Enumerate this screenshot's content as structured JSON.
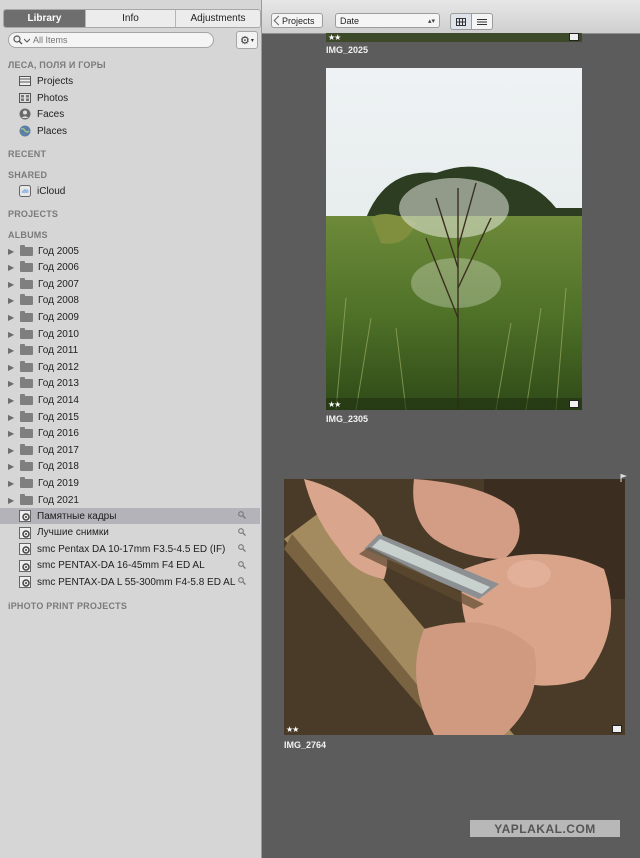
{
  "sidebar": {
    "tabs": [
      {
        "label": "Library",
        "active": true
      },
      {
        "label": "Info",
        "active": false
      },
      {
        "label": "Adjustments",
        "active": false
      }
    ],
    "search_placeholder": "All Items",
    "library_title": "ЛЕСА, ПОЛЯ И ГОРЫ",
    "library_items": [
      {
        "label": "Projects",
        "icon": "projects-icon"
      },
      {
        "label": "Photos",
        "icon": "photos-icon"
      },
      {
        "label": "Faces",
        "icon": "faces-icon"
      },
      {
        "label": "Places",
        "icon": "places-icon"
      }
    ],
    "recent_title": "RECENT",
    "shared_title": "SHARED",
    "shared_items": [
      {
        "label": "iCloud",
        "icon": "icloud-icon"
      }
    ],
    "projects_title": "PROJECTS",
    "albums_title": "ALBUMS",
    "album_folders": [
      "Год 2005",
      "Год 2006",
      "Год 2007",
      "Год 2008",
      "Год 2009",
      "Год 2010",
      "Год 2011",
      "Год 2012",
      "Год 2013",
      "Год 2014",
      "Год 2015",
      "Год 2016",
      "Год 2017",
      "Год 2018",
      "Год 2019",
      "Год 2021"
    ],
    "smart_albums": [
      {
        "label": "Памятные кадры",
        "selected": true
      },
      {
        "label": "Лучшие снимки",
        "selected": false
      },
      {
        "label": "smc Pentax DA 10-17mm F3.5-4.5 ED (IF)",
        "selected": false
      },
      {
        "label": "smc PENTAX-DA 16-45mm F4 ED AL",
        "selected": false
      },
      {
        "label": "smc PENTAX-DA L 55-300mm F4-5.8 ED AL",
        "selected": false
      }
    ],
    "iphoto_title": "iPHOTO PRINT PROJECTS"
  },
  "toolbar": {
    "back_label": "Projects",
    "sort_value": "Date"
  },
  "photos": [
    {
      "name": "IMG_2025",
      "stars": "★★"
    },
    {
      "name": "IMG_2305",
      "stars": "★★"
    },
    {
      "name": "IMG_2764",
      "stars": "★★"
    }
  ],
  "watermark": "YAPLAKAL.COM",
  "colors": {
    "sidebar_bg": "#d6d6d6",
    "main_bg": "#5c5c5c",
    "selected_row": "#b3b3b9",
    "section_title": "#7a7a7a"
  }
}
